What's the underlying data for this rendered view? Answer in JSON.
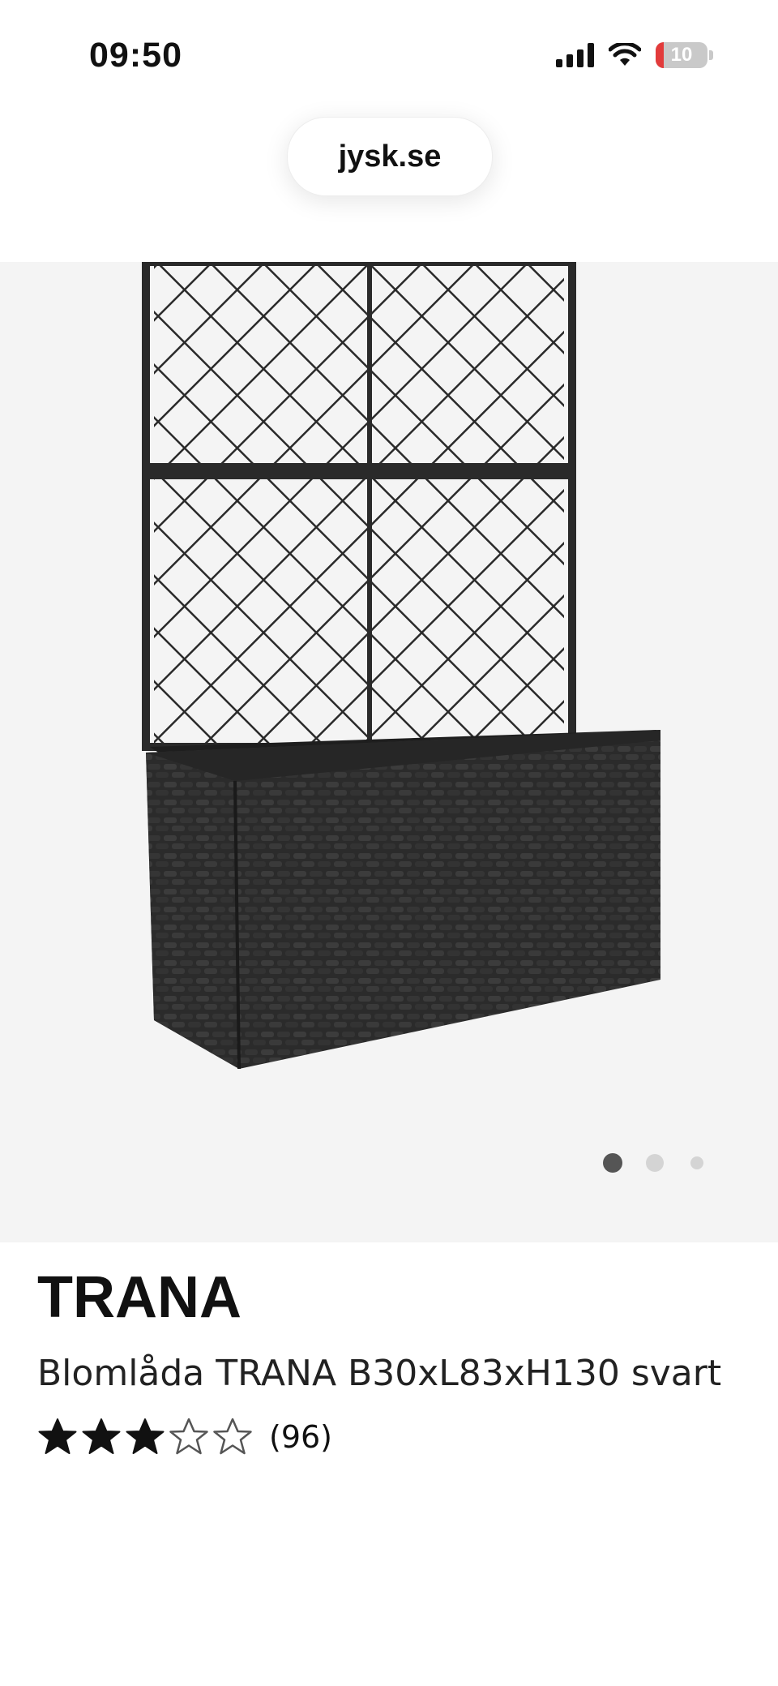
{
  "status_bar": {
    "time": "09:50",
    "battery_level": "10",
    "icons": [
      "cellular-signal-icon",
      "wifi-icon",
      "battery-icon"
    ]
  },
  "browser": {
    "url": "jysk.se"
  },
  "gallery": {
    "image_subject": "black rattan planter box with trellis",
    "pages": 3,
    "active_page": 1
  },
  "product": {
    "brand": "TRANA",
    "description": "Blomlåda TRANA B30xL83xH130 svart",
    "rating": {
      "stars": 3,
      "max": 5,
      "count": "(96)"
    }
  },
  "colors": {
    "gallery_bg": "#f4f4f4",
    "battery_low": "#e23b3b",
    "dot_active": "#555555",
    "dot_inactive": "#d4d4d4"
  }
}
